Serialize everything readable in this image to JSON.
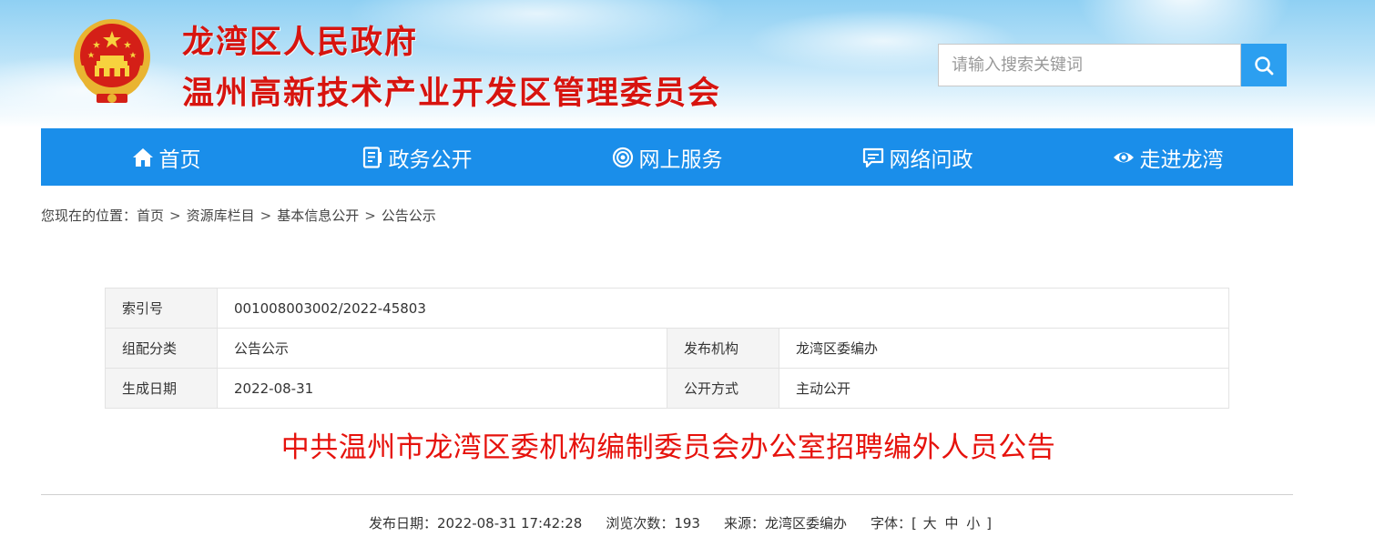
{
  "header": {
    "title_line1": "龙湾区人民政府",
    "title_line2": "温州高新技术产业开发区管理委员会"
  },
  "search": {
    "placeholder": "请输入搜索关键词",
    "value": ""
  },
  "nav": {
    "items": [
      {
        "label": "首页",
        "icon": "home-icon"
      },
      {
        "label": "政务公开",
        "icon": "document-icon"
      },
      {
        "label": "网上服务",
        "icon": "service-icon"
      },
      {
        "label": "网络问政",
        "icon": "chat-icon"
      },
      {
        "label": "走进龙湾",
        "icon": "eye-icon"
      }
    ]
  },
  "breadcrumb": {
    "prefix": "您现在的位置：",
    "items": [
      "首页",
      "资源库栏目",
      "基本信息公开",
      "公告公示"
    ],
    "separator": ">"
  },
  "meta": {
    "index_label": "索引号",
    "index_value": "001008003002/2022-45803",
    "category_label": "组配分类",
    "category_value": "公告公示",
    "publisher_label": "发布机构",
    "publisher_value": "龙湾区委编办",
    "date_label": "生成日期",
    "date_value": "2022-08-31",
    "open_label": "公开方式",
    "open_value": "主动公开"
  },
  "article": {
    "title": "中共温州市龙湾区委机构编制委员会办公室招聘编外人员公告",
    "publish_date_label": "发布日期：",
    "publish_date": "2022-08-31 17:42:28",
    "views_label": "浏览次数：",
    "views": "193",
    "source_label": "来源：",
    "source": "龙湾区委编办",
    "font_label": "字体：",
    "font_open": "[",
    "font_large": "大",
    "font_medium": "中",
    "font_small": "小",
    "font_close": "]"
  },
  "colors": {
    "brand_red": "#d7140f",
    "nav_blue": "#1a8eea",
    "search_blue": "#2c9ff0",
    "title_red": "#e6120c"
  }
}
